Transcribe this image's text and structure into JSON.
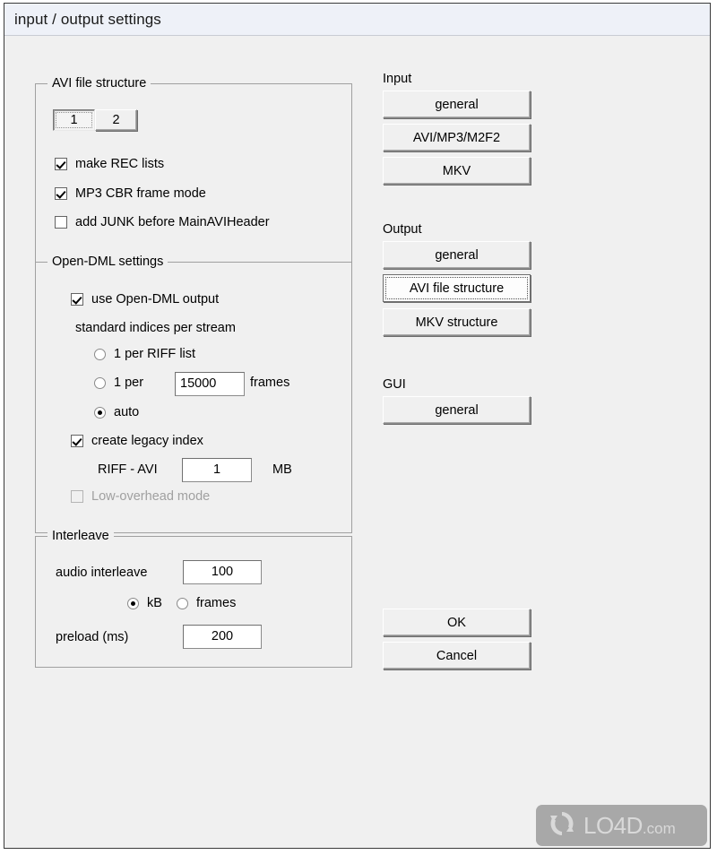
{
  "window": {
    "title": "input / output settings"
  },
  "avi_group": {
    "label": "AVI file structure",
    "tabs": [
      {
        "label": "1",
        "selected": true
      },
      {
        "label": "2",
        "selected": false
      }
    ],
    "checkboxes": [
      {
        "label": "make REC lists",
        "checked": true,
        "enabled": true
      },
      {
        "label": "MP3 CBR frame mode",
        "checked": true,
        "enabled": true
      },
      {
        "label": "add JUNK before MainAVIHeader",
        "checked": false,
        "enabled": true
      }
    ]
  },
  "opendml_group": {
    "label": "Open-DML settings",
    "use_opendml": {
      "label": "use Open-DML output",
      "checked": true
    },
    "indices_label": "standard indices per stream",
    "radios": [
      {
        "label": "1 per RIFF list",
        "checked": false
      },
      {
        "label": "1 per",
        "checked": false,
        "suffix": "frames",
        "value": "15000"
      },
      {
        "label": "auto",
        "checked": true
      }
    ],
    "legacy_index": {
      "label": "create legacy index",
      "checked": true
    },
    "riff_avi": {
      "label": "RIFF - AVI",
      "value": "1",
      "unit": "MB"
    },
    "low_overhead": {
      "label": "Low-overhead mode",
      "checked": false,
      "enabled": false
    }
  },
  "interleave_group": {
    "label": "Interleave",
    "audio_interleave": {
      "label": "audio interleave",
      "value": "100"
    },
    "units": [
      {
        "label": "kB",
        "checked": true
      },
      {
        "label": "frames",
        "checked": false
      }
    ],
    "preload": {
      "label": "preload (ms)",
      "value": "200"
    }
  },
  "sections": {
    "input": {
      "label": "Input",
      "buttons": [
        {
          "label": "general",
          "focused": false
        },
        {
          "label": "AVI/MP3/M2F2",
          "focused": false
        },
        {
          "label": "MKV",
          "focused": false
        }
      ]
    },
    "output": {
      "label": "Output",
      "buttons": [
        {
          "label": "general",
          "focused": false
        },
        {
          "label": "AVI file structure",
          "focused": true
        },
        {
          "label": "MKV structure",
          "focused": false
        }
      ]
    },
    "gui": {
      "label": "GUI",
      "buttons": [
        {
          "label": "general",
          "focused": false
        }
      ]
    }
  },
  "actions": {
    "ok": "OK",
    "cancel": "Cancel"
  },
  "watermark": {
    "name": "LO4D",
    "suffix": ".com",
    "icon": "sync-arrows-icon"
  }
}
